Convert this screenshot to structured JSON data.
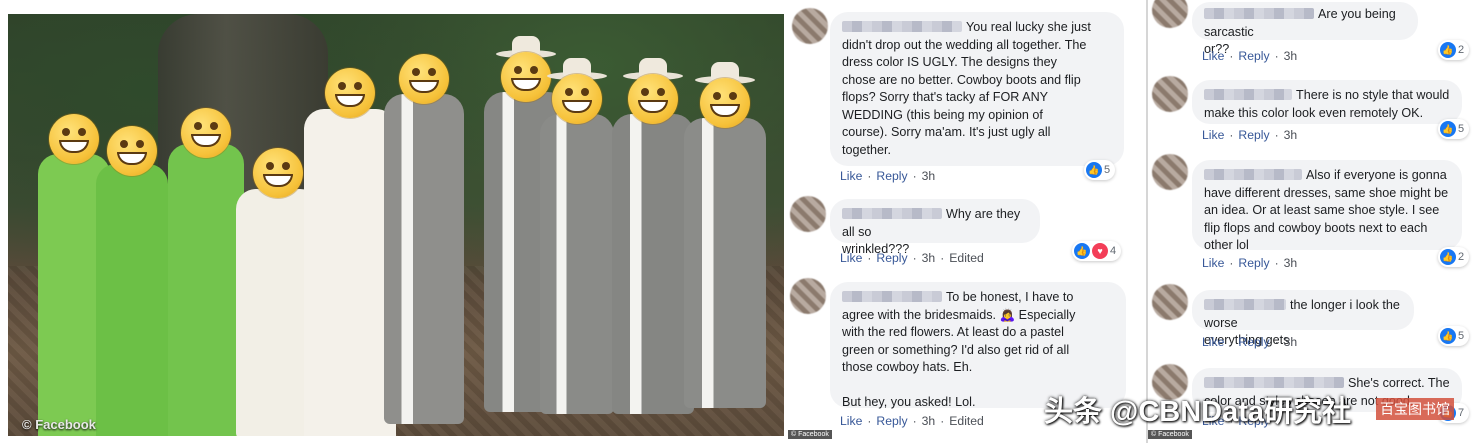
{
  "photo": {
    "watermark": "© Facebook",
    "people": [
      {
        "kind": "bridesmaid",
        "dress": "#7dca52"
      },
      {
        "kind": "bridesmaid",
        "dress": "#6cc046"
      },
      {
        "kind": "bridesmaid",
        "dress": "#73c44d"
      },
      {
        "kind": "flowergirl",
        "dress": "#f2efe6"
      },
      {
        "kind": "bride",
        "dress": "#f4f1ea"
      },
      {
        "kind": "groom",
        "dress": "#8f8f8c"
      },
      {
        "kind": "groomsman",
        "dress": "#868784"
      },
      {
        "kind": "groomsman",
        "dress": "#8a8b88"
      },
      {
        "kind": "groomsman",
        "dress": "#858683"
      },
      {
        "kind": "groomsman",
        "dress": "#8b8c89"
      }
    ]
  },
  "left_comments": [
    {
      "text": "You real lucky she just\ndidn't drop out the wedding all together. The\ndress color IS UGLY. The designs they\nchose are no better. Cowboy boots and flip\nflops? Sorry that's tacky af FOR ANY\nWEDDING (this being my opinion of\ncourse). Sorry ma'am. It's just ugly all\ntogether.",
      "like": "Like",
      "reply": "Reply",
      "time": "3h",
      "edited": "",
      "reaction_count": "5"
    },
    {
      "text": "Why are they all so\nwrinkled???",
      "like": "Like",
      "reply": "Reply",
      "time": "3h",
      "edited": "Edited",
      "reaction_count": "4"
    },
    {
      "text": "To be honest, I have to\nagree with the bridesmaids. 🙇‍♀️ Especially\nwith the red flowers. At least do a pastel\ngreen or something? I'd also get rid of all\nthose cowboy hats. Eh.\n\nBut hey, you asked! Lol.",
      "like": "Like",
      "reply": "Reply",
      "time": "3h",
      "edited": "Edited",
      "reaction_count": ""
    }
  ],
  "right_comments": [
    {
      "text": "Are you being sarcastic\nor??",
      "like": "Like",
      "reply": "Reply",
      "time": "3h",
      "reaction_count": "2"
    },
    {
      "text": "There is no style that would\nmake this color look even remotely OK.",
      "like": "Like",
      "reply": "Reply",
      "time": "3h",
      "reaction_count": "5"
    },
    {
      "text": "Also if everyone is gonna\nhave different dresses, same shoe might be\nan idea. Or at least same shoe style. I see\nflip flops and cowboy boots next to each\nother lol",
      "like": "Like",
      "reply": "Reply",
      "time": "3h",
      "reaction_count": "2"
    },
    {
      "text": "the longer i look the worse\neverything gets",
      "like": "Like",
      "reply": "Reply",
      "time": "3h",
      "reaction_count": "5"
    },
    {
      "text": "She's correct. The\ncolor and styles chosen are not good.",
      "like": "Like",
      "reply": "Reply",
      "time": "",
      "reaction_count": "7"
    }
  ],
  "credits": {
    "left": "© Facebook",
    "right": "© Facebook"
  },
  "overlay": {
    "text": "头条 @CBNData研究社",
    "site": "百宝图书馆"
  }
}
